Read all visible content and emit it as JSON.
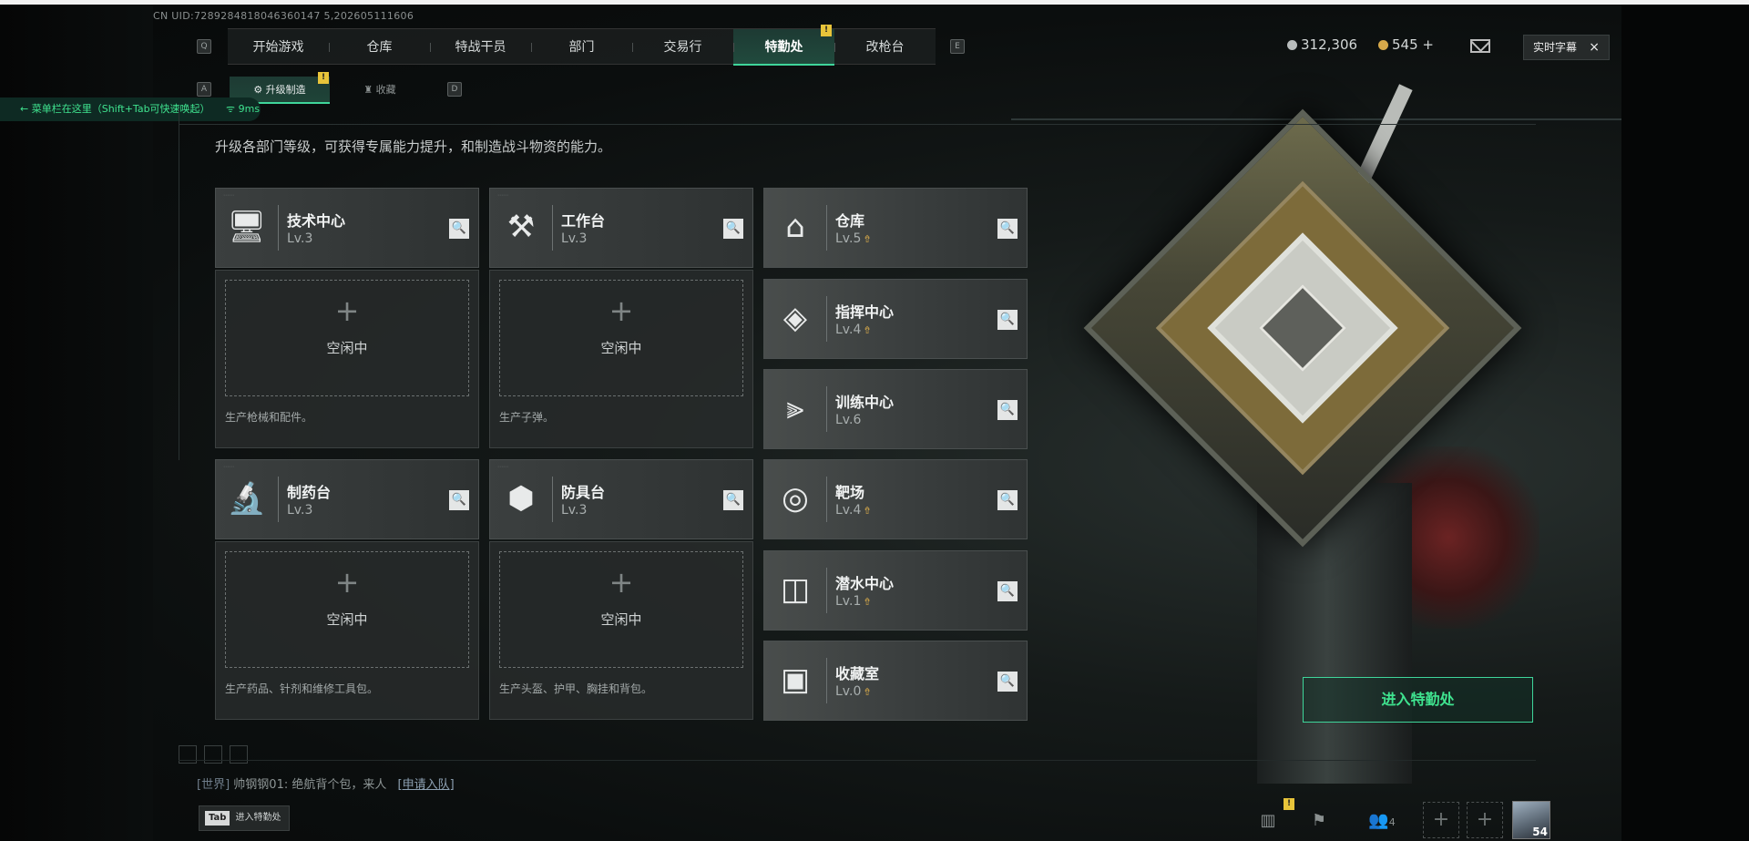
{
  "uid": "CN UID:7289284818046360147 5,202605111606",
  "nav": {
    "key_left": "Q",
    "key_right": "E",
    "tabs": [
      "开始游戏",
      "仓库",
      "特战干员",
      "部门",
      "交易行",
      "特勤处",
      "改枪台"
    ],
    "active_index": 5,
    "alert_badge": "!"
  },
  "subnav": {
    "key_left": "A",
    "key_right": "D",
    "tabs": [
      "升级制造",
      "收藏"
    ],
    "active_index": 0,
    "alert_badge": "!"
  },
  "toast": {
    "text": "菜单栏在这里（Shift+Tab可快速唤起）",
    "ping": "9ms"
  },
  "currency": {
    "silver": "312,306",
    "gold": "545",
    "gold_add": "+"
  },
  "subtitle_button": {
    "label": "实时字幕",
    "close": "×"
  },
  "description": "升级各部门等级，可获得专属能力提升，和制造战斗物资的能力。",
  "production": [
    {
      "name": "技术中心",
      "level": "Lv.3",
      "icon": "computer-icon",
      "glyph": "🖥",
      "slot_plus": "+",
      "slot_status": "空闲中",
      "caption": "生产枪械和配件。"
    },
    {
      "name": "工作台",
      "level": "Lv.3",
      "icon": "tools-icon",
      "glyph": "⚒",
      "slot_plus": "+",
      "slot_status": "空闲中",
      "caption": "生产子弹。"
    },
    {
      "name": "制药台",
      "level": "Lv.3",
      "icon": "microscope-icon",
      "glyph": "🔬",
      "slot_plus": "+",
      "slot_status": "空闲中",
      "caption": "生产药品、针剂和维修工具包。"
    },
    {
      "name": "防具台",
      "level": "Lv.3",
      "icon": "armor-blocks-icon",
      "glyph": "⬢",
      "slot_plus": "+",
      "slot_status": "空闲中",
      "caption": "生产头盔、护甲、胸挂和背包。"
    }
  ],
  "departments": [
    {
      "name": "仓库",
      "level": "Lv.5",
      "upgradable": true,
      "icon": "warehouse-icon",
      "glyph": "⌂"
    },
    {
      "name": "指挥中心",
      "level": "Lv.4",
      "upgradable": true,
      "icon": "command-center-icon",
      "glyph": "◈"
    },
    {
      "name": "训练中心",
      "level": "Lv.6",
      "upgradable": false,
      "icon": "dumbbell-icon",
      "glyph": "⫸"
    },
    {
      "name": "靶场",
      "level": "Lv.4",
      "upgradable": true,
      "icon": "target-icon",
      "glyph": "◎"
    },
    {
      "name": "潜水中心",
      "level": "Lv.1",
      "upgradable": true,
      "icon": "diving-goggles-icon",
      "glyph": "◫"
    },
    {
      "name": "收藏室",
      "level": "Lv.0",
      "upgradable": true,
      "icon": "collection-room-icon",
      "glyph": "▣"
    }
  ],
  "upgrade_glyph": "⇮",
  "zoom_glyph": "🔍",
  "enter_button": "进入特勤处",
  "chat": {
    "channel": "[世界]",
    "message": "帅钢钢01: 绝航背个包，来人",
    "link": "[申请入队]"
  },
  "tab_button": {
    "key": "Tab",
    "label": "进入特勤处"
  },
  "bottom": {
    "friends_count": "4",
    "level": "54",
    "alert_badge": "!"
  },
  "colors": {
    "accent": "#3fd59a",
    "badge": "#e8c43a",
    "upgrade": "#d6a84a"
  }
}
